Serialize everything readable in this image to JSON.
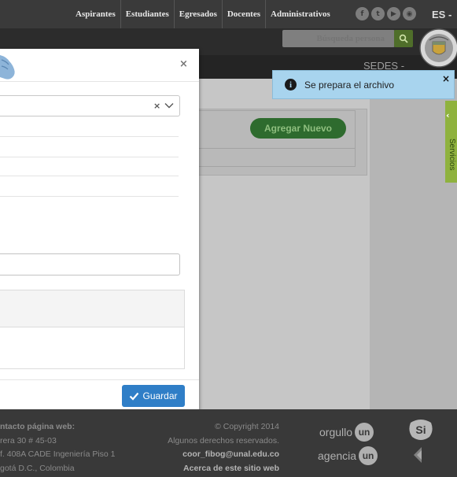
{
  "topnav": {
    "items": [
      "Aspirantes",
      "Estudiantes",
      "Egresados",
      "Docentes",
      "Administrativos"
    ],
    "social_icons": [
      "facebook-icon",
      "twitter-icon",
      "youtube-icon",
      "rss-icon"
    ],
    "lang": "ES",
    "lang_caret": "-"
  },
  "header": {
    "search_placeholder": "Búsqueda persona",
    "sedes": "SEDES",
    "sedes_caret": "-"
  },
  "toast": {
    "text": "Se prepara el archivo",
    "icon": "info-icon",
    "info_glyph": "i",
    "close": "×"
  },
  "main": {
    "add_button": "Agregar Nuevo"
  },
  "services_tab": {
    "label": "Servicios",
    "chevron": "‹"
  },
  "modal": {
    "close": "×",
    "select_clear": "×",
    "save_button": "Guardar"
  },
  "footer": {
    "contact_title": "ntacto página web:",
    "address_line1": "rera 30 # 45-03",
    "address_line2": "f. 408A CADE Ingeniería Piso 1",
    "address_line3": "gotá D.C., Colombia",
    "copyright": "© Copyright 2014",
    "rights": "Algunos derechos reservados.",
    "email": "coor_fibog@unal.edu.co",
    "about": "Acerca de este sitio web",
    "brand1_text": "orgullo",
    "brand2_text": "agencia",
    "brand_badge": "un",
    "si_mark": "Si"
  },
  "colors": {
    "topbar": "#3a3a3a",
    "toast_bg": "#a8d4ee",
    "save_button": "#2f7ec7",
    "add_button": "#2e6b2e",
    "services_tab": "#8fb23e"
  }
}
